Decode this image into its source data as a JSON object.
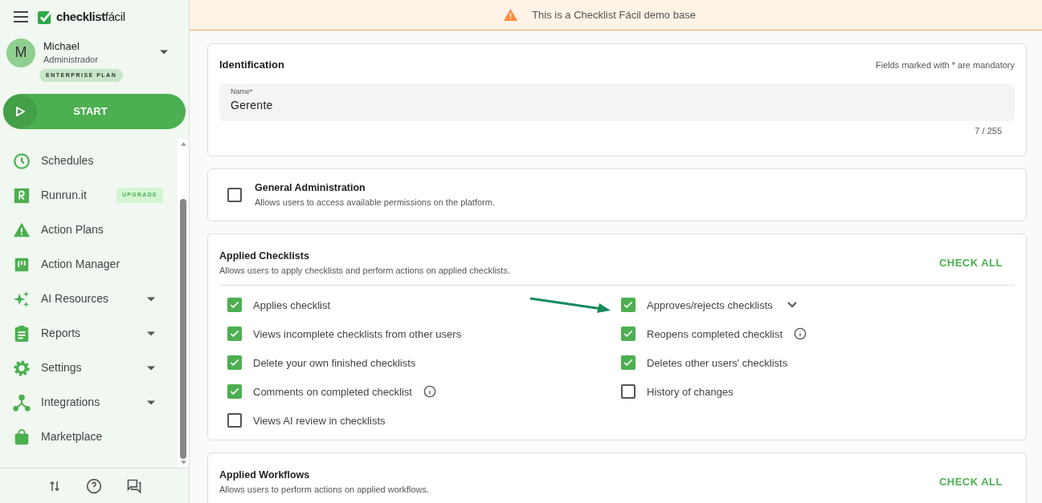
{
  "sidebar": {
    "logo": {
      "brand": "checklist",
      "brand_suffix": "fácil"
    },
    "user": {
      "initial": "M",
      "name": "Michael",
      "role": "Administrador",
      "plan": "ENTERPRISE PLAN"
    },
    "start_button": "START",
    "items": [
      {
        "label": "Schedules",
        "expandable": false
      },
      {
        "label": "Runrun.it",
        "expandable": false,
        "badge": "UPGRADE"
      },
      {
        "label": "Action Plans",
        "expandable": false
      },
      {
        "label": "Action Manager",
        "expandable": false
      },
      {
        "label": "AI Resources",
        "expandable": true
      },
      {
        "label": "Reports",
        "expandable": true
      },
      {
        "label": "Settings",
        "expandable": true
      },
      {
        "label": "Integrations",
        "expandable": true
      },
      {
        "label": "Marketplace",
        "expandable": false
      }
    ]
  },
  "banner": {
    "text": "This is a Checklist Fácil demo base"
  },
  "identification": {
    "title": "Identification",
    "note": "Fields marked with * are mandatory",
    "field": {
      "label": "Name*",
      "value": "Gerente",
      "counter": "7 / 255"
    }
  },
  "general_administration": {
    "title": "General Administration",
    "description": "Allows users to access available permissions on the platform.",
    "checked": false
  },
  "sections": [
    {
      "title": "Applied Checklists",
      "description": "Allows users to apply checklists and perform actions on applied checklists.",
      "action": "CHECK ALL",
      "permissions": [
        {
          "label": "Applies checklist",
          "checked": true,
          "info": false,
          "expandable": false,
          "pointed": false
        },
        {
          "label": "Approves/rejects checklists",
          "checked": true,
          "info": false,
          "expandable": true,
          "pointed": true
        },
        {
          "label": "Views incomplete checklists from other users",
          "checked": true,
          "info": false,
          "expandable": false,
          "pointed": false
        },
        {
          "label": "Reopens completed checklist",
          "checked": true,
          "info": true,
          "expandable": false,
          "pointed": false
        },
        {
          "label": "Delete your own finished checklists",
          "checked": true,
          "info": false,
          "expandable": false,
          "pointed": false
        },
        {
          "label": "Deletes other users' checklists",
          "checked": true,
          "info": false,
          "expandable": false,
          "pointed": false
        },
        {
          "label": "Comments on completed checklist",
          "checked": true,
          "info": true,
          "expandable": false,
          "pointed": false
        },
        {
          "label": "History of changes",
          "checked": false,
          "info": false,
          "expandable": false,
          "pointed": false
        },
        {
          "label": "Views AI review in checklists",
          "checked": false,
          "info": false,
          "expandable": false,
          "pointed": false
        }
      ]
    },
    {
      "title": "Applied Workflows",
      "description": "Allows users to perform actions on applied workflows.",
      "action": "CHECK ALL"
    }
  ]
}
